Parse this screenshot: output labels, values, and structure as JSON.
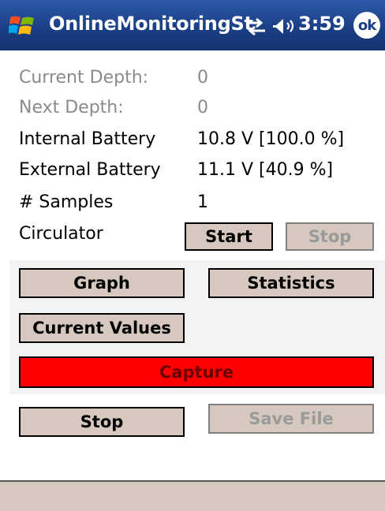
{
  "titlebar": {
    "app_title": "OnlineMonitoringSt",
    "time": "3:59",
    "ok_label": "ok",
    "icons": [
      "windows-start-icon",
      "network-sync-icon",
      "speaker-icon"
    ]
  },
  "info": {
    "current_depth_label": "Current Depth:",
    "current_depth_value": "0",
    "next_depth_label": "Next Depth:",
    "next_depth_value": "0",
    "internal_battery_label": "Internal Battery",
    "internal_battery_value": "10.8 V [100.0 %]",
    "external_battery_label": "External Battery",
    "external_battery_value": "11.1 V [40.9 %]",
    "samples_label": "# Samples",
    "samples_value": "1",
    "circulator_label": "Circulator"
  },
  "circulator": {
    "start_label": "Start",
    "stop_label": "Stop"
  },
  "buttons": {
    "graph": "Graph",
    "statistics": "Statistics",
    "current_values": "Current Values",
    "capture": "Capture",
    "stop": "Stop",
    "save_file": "Save File"
  },
  "colors": {
    "titlebar": "#1a3f86",
    "button_face": "#d6c8be",
    "capture": "#ff0000",
    "disabled_text": "#9a9a9a"
  }
}
